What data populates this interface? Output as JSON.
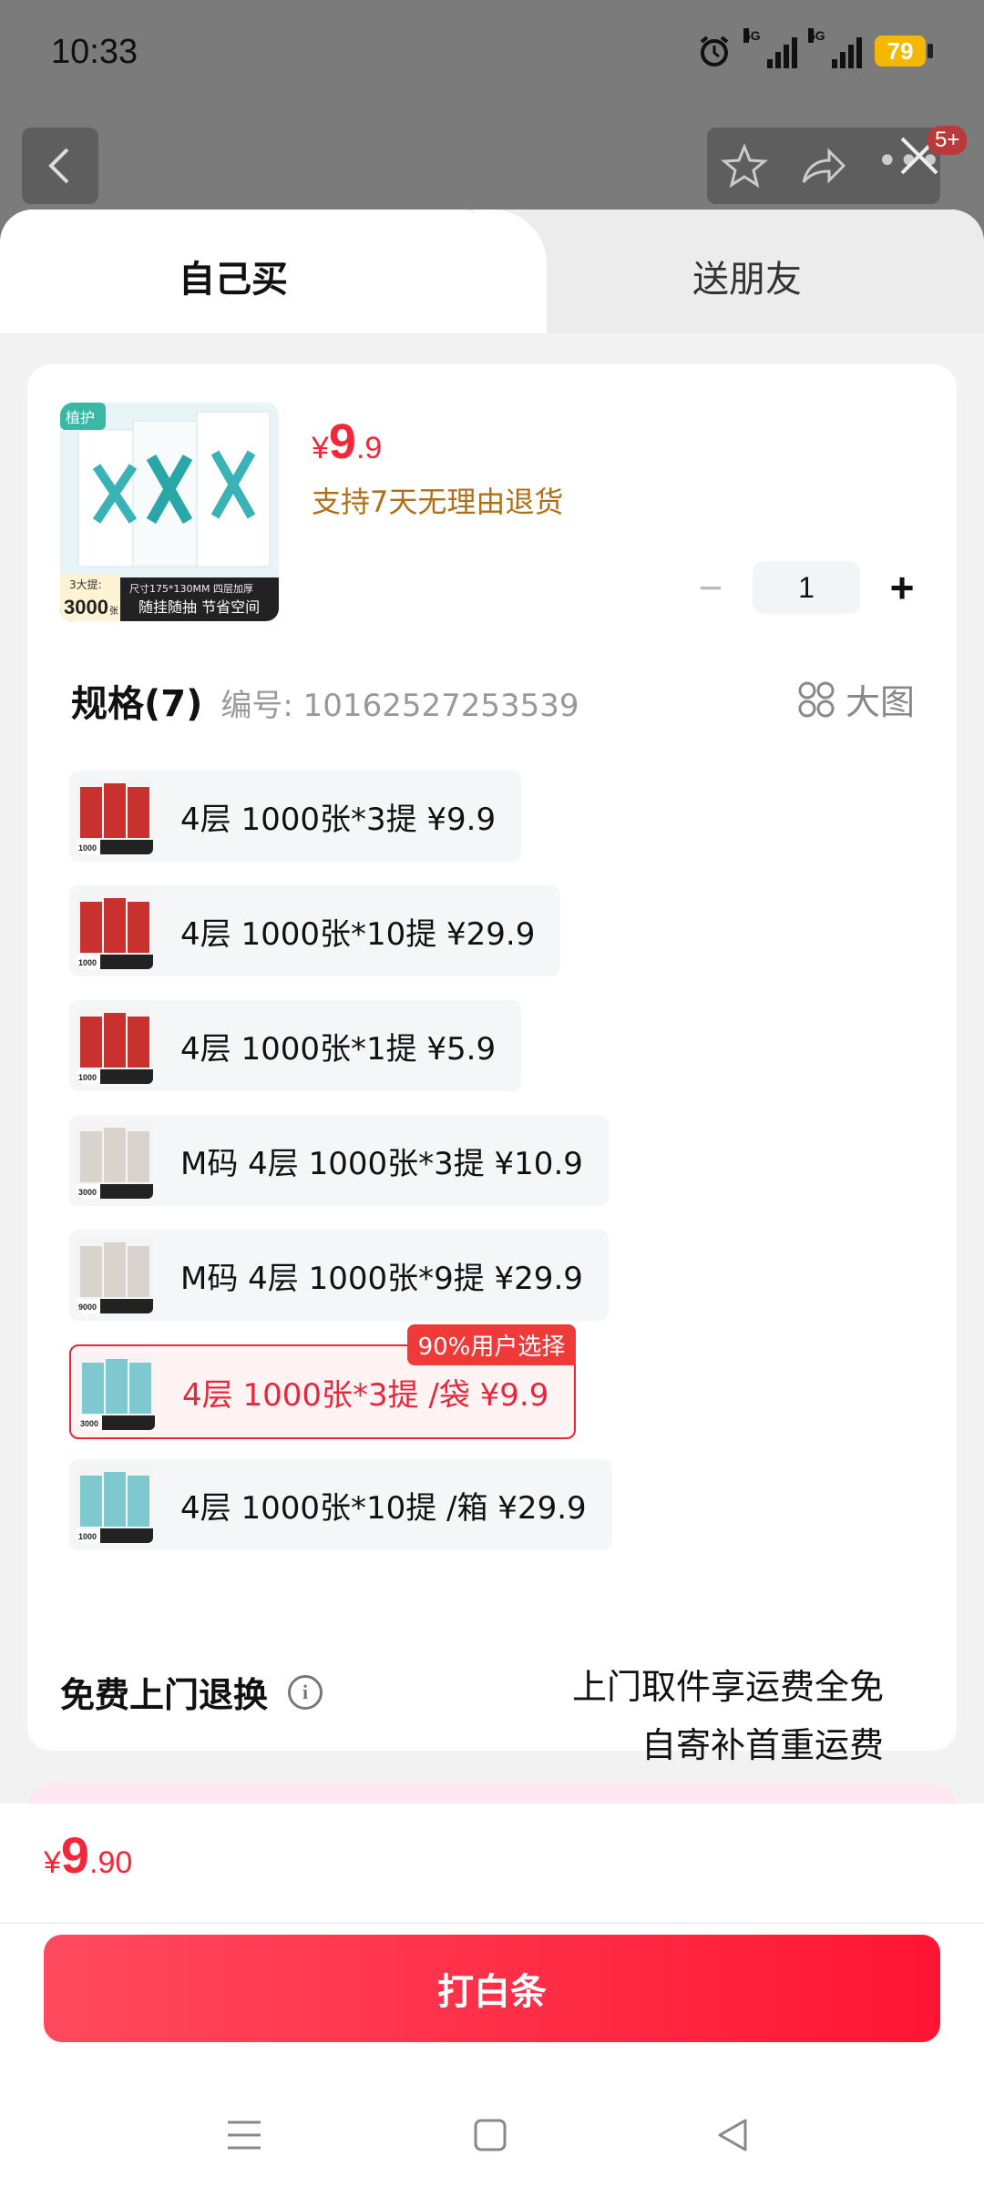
{
  "status": {
    "time": "10:33",
    "net1": "5G",
    "net2": "5G",
    "battery": "79"
  },
  "header": {
    "badge": "5+"
  },
  "tabs": {
    "self": "自己买",
    "gift": "送朋友"
  },
  "product": {
    "currency": "¥",
    "price_int": "9",
    "price_dec": ".9",
    "return_note": "支持7天无理由退货",
    "quantity": "1",
    "thumb_brand": "植护",
    "thumb_size": "尺寸175*130MM 四层加厚",
    "thumb_pack": "3大提:",
    "thumb_count": "3000",
    "thumb_count_unit": "张",
    "thumb_slogan": "随挂随抽 节省空间"
  },
  "spec": {
    "title": "规格(7)",
    "code": "编号: 10162527253539",
    "bigview": "大图",
    "items": [
      {
        "label": "4层 1000张*3提   ¥9.9",
        "color": "#c9312e",
        "thumb_num": "1000"
      },
      {
        "label": "4层 1000张*10提   ¥29.9",
        "color": "#c9312e",
        "thumb_num": "1000"
      },
      {
        "label": "4层 1000张*1提   ¥5.9",
        "color": "#c9312e",
        "thumb_num": "1000"
      },
      {
        "label": "M码 4层 1000张*3提   ¥10.9",
        "color": "#d8d3cc",
        "thumb_num": "3000"
      },
      {
        "label": "M码 4层 1000张*9提   ¥29.9",
        "color": "#d8d3cc",
        "thumb_num": "9000"
      },
      {
        "label": "4层 1000张*3提 /袋   ¥9.9",
        "color": "#7ec9cf",
        "thumb_num": "3000",
        "badge": "90%用户选择"
      },
      {
        "label": "4层 1000张*10提 /箱   ¥29.9",
        "color": "#7ec9cf",
        "thumb_num": "1000"
      }
    ]
  },
  "service": {
    "title": "免费上门退换",
    "info_icon": "i",
    "line1": "上门取件享运费全免",
    "line2": "自寄补首重运费"
  },
  "footer": {
    "currency": "¥",
    "total_int": "9",
    "total_dec": ".90",
    "pay_label": "打白条"
  },
  "colors": {
    "accent": "#f2273a",
    "return_note": "#b0701b"
  }
}
